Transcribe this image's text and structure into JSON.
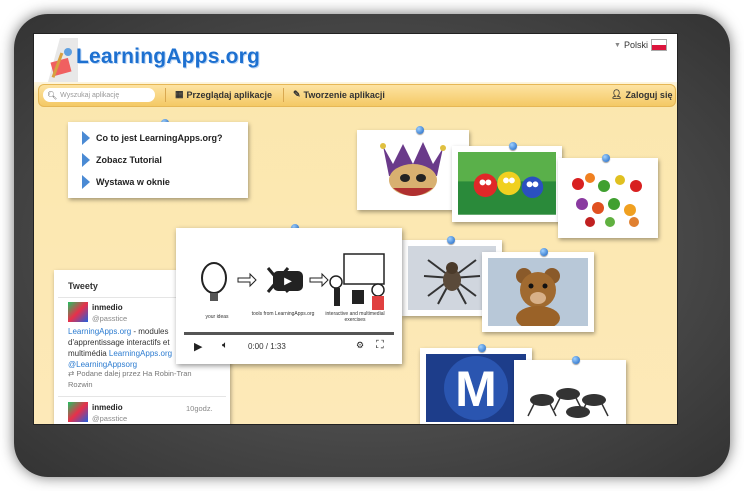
{
  "site": {
    "logo_text": "LearningApps.org",
    "language": "Polski"
  },
  "nav": {
    "search_placeholder": "Wyszukaj aplikację",
    "browse_label": "Przeglądaj aplikacje",
    "create_label": "Tworzenie aplikacji",
    "login_label": "Zaloguj się"
  },
  "menu": {
    "items": [
      "Co to jest LearningApps.org?",
      "Zobacz Tutorial",
      "Wystawa w oknie"
    ]
  },
  "tweets": {
    "title": "Tweety",
    "tweet1": {
      "name": "inmedio",
      "handle": "@passtice",
      "text_link1": "LearningApps.org",
      "text1": " - modules d'apprentissage interactifs et multimédia ",
      "text_link2": "LearningApps.org",
      "text_link3": "@LearningAppsorg",
      "retweet": "Podane dalej przez Ha Robin-Tran Rozwin"
    },
    "tweet2": {
      "name": "inmedio",
      "handle": "@passtice",
      "time": "10godz."
    }
  },
  "video": {
    "time": "0:00 / 1:33",
    "caption1": "your ideas",
    "caption2": "tools from LearningApps.org",
    "caption3": "interactive and multimedial exercises"
  },
  "colors": {
    "accent": "#1d70d0",
    "nav_bg": "#f4c965",
    "page_bg": "#fde9b8"
  }
}
